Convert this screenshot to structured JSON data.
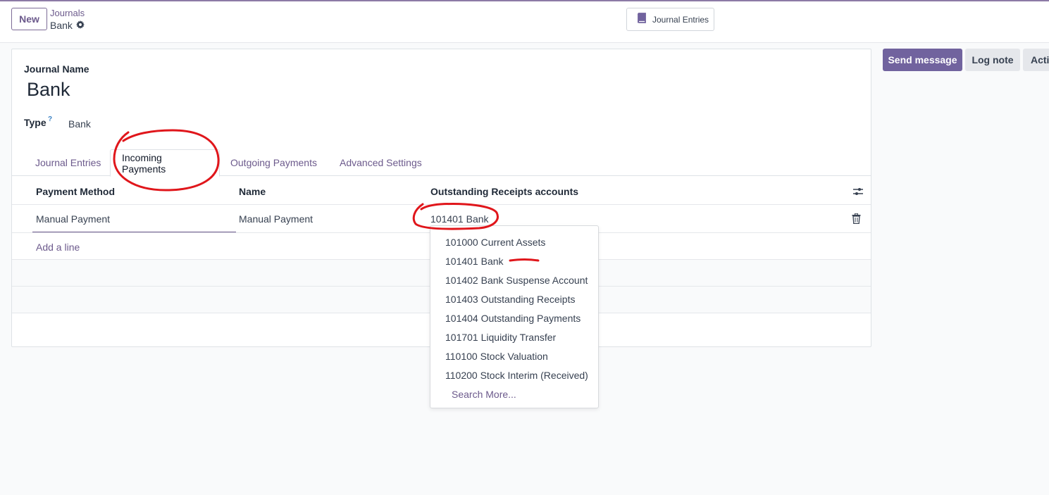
{
  "control_panel": {
    "new_label": "New",
    "breadcrumb_parent": "Journals",
    "breadcrumb_current": "Bank",
    "smart_button_label": "Journal Entries"
  },
  "form": {
    "journal_name_label": "Journal Name",
    "journal_name_value": "Bank",
    "type_label": "Type",
    "type_help": "?",
    "type_value": "Bank"
  },
  "tabs": [
    {
      "label": "Journal Entries",
      "active": false
    },
    {
      "label": "Incoming Payments",
      "active": true
    },
    {
      "label": "Outgoing Payments",
      "active": false
    },
    {
      "label": "Advanced Settings",
      "active": false
    }
  ],
  "table": {
    "columns": [
      "Payment Method",
      "Name",
      "Outstanding Receipts accounts"
    ],
    "rows": [
      {
        "payment_method": "Manual Payment",
        "name": "Manual Payment",
        "account": "101401 Bank"
      }
    ],
    "add_line_label": "Add a line"
  },
  "dropdown": {
    "items": [
      "101000 Current Assets",
      "101401 Bank",
      "101402 Bank Suspense Account",
      "101403 Outstanding Receipts",
      "101404 Outstanding Payments",
      "101701 Liquidity Transfer",
      "110100 Stock Valuation",
      "110200 Stock Interim (Received)"
    ],
    "search_more": "Search More..."
  },
  "chatter": {
    "send_message": "Send message",
    "log_note": "Log note",
    "activities": "Acti"
  },
  "colors": {
    "brand": "#71639e",
    "link": "#6c5a8c",
    "annotation": "#e0161b"
  }
}
